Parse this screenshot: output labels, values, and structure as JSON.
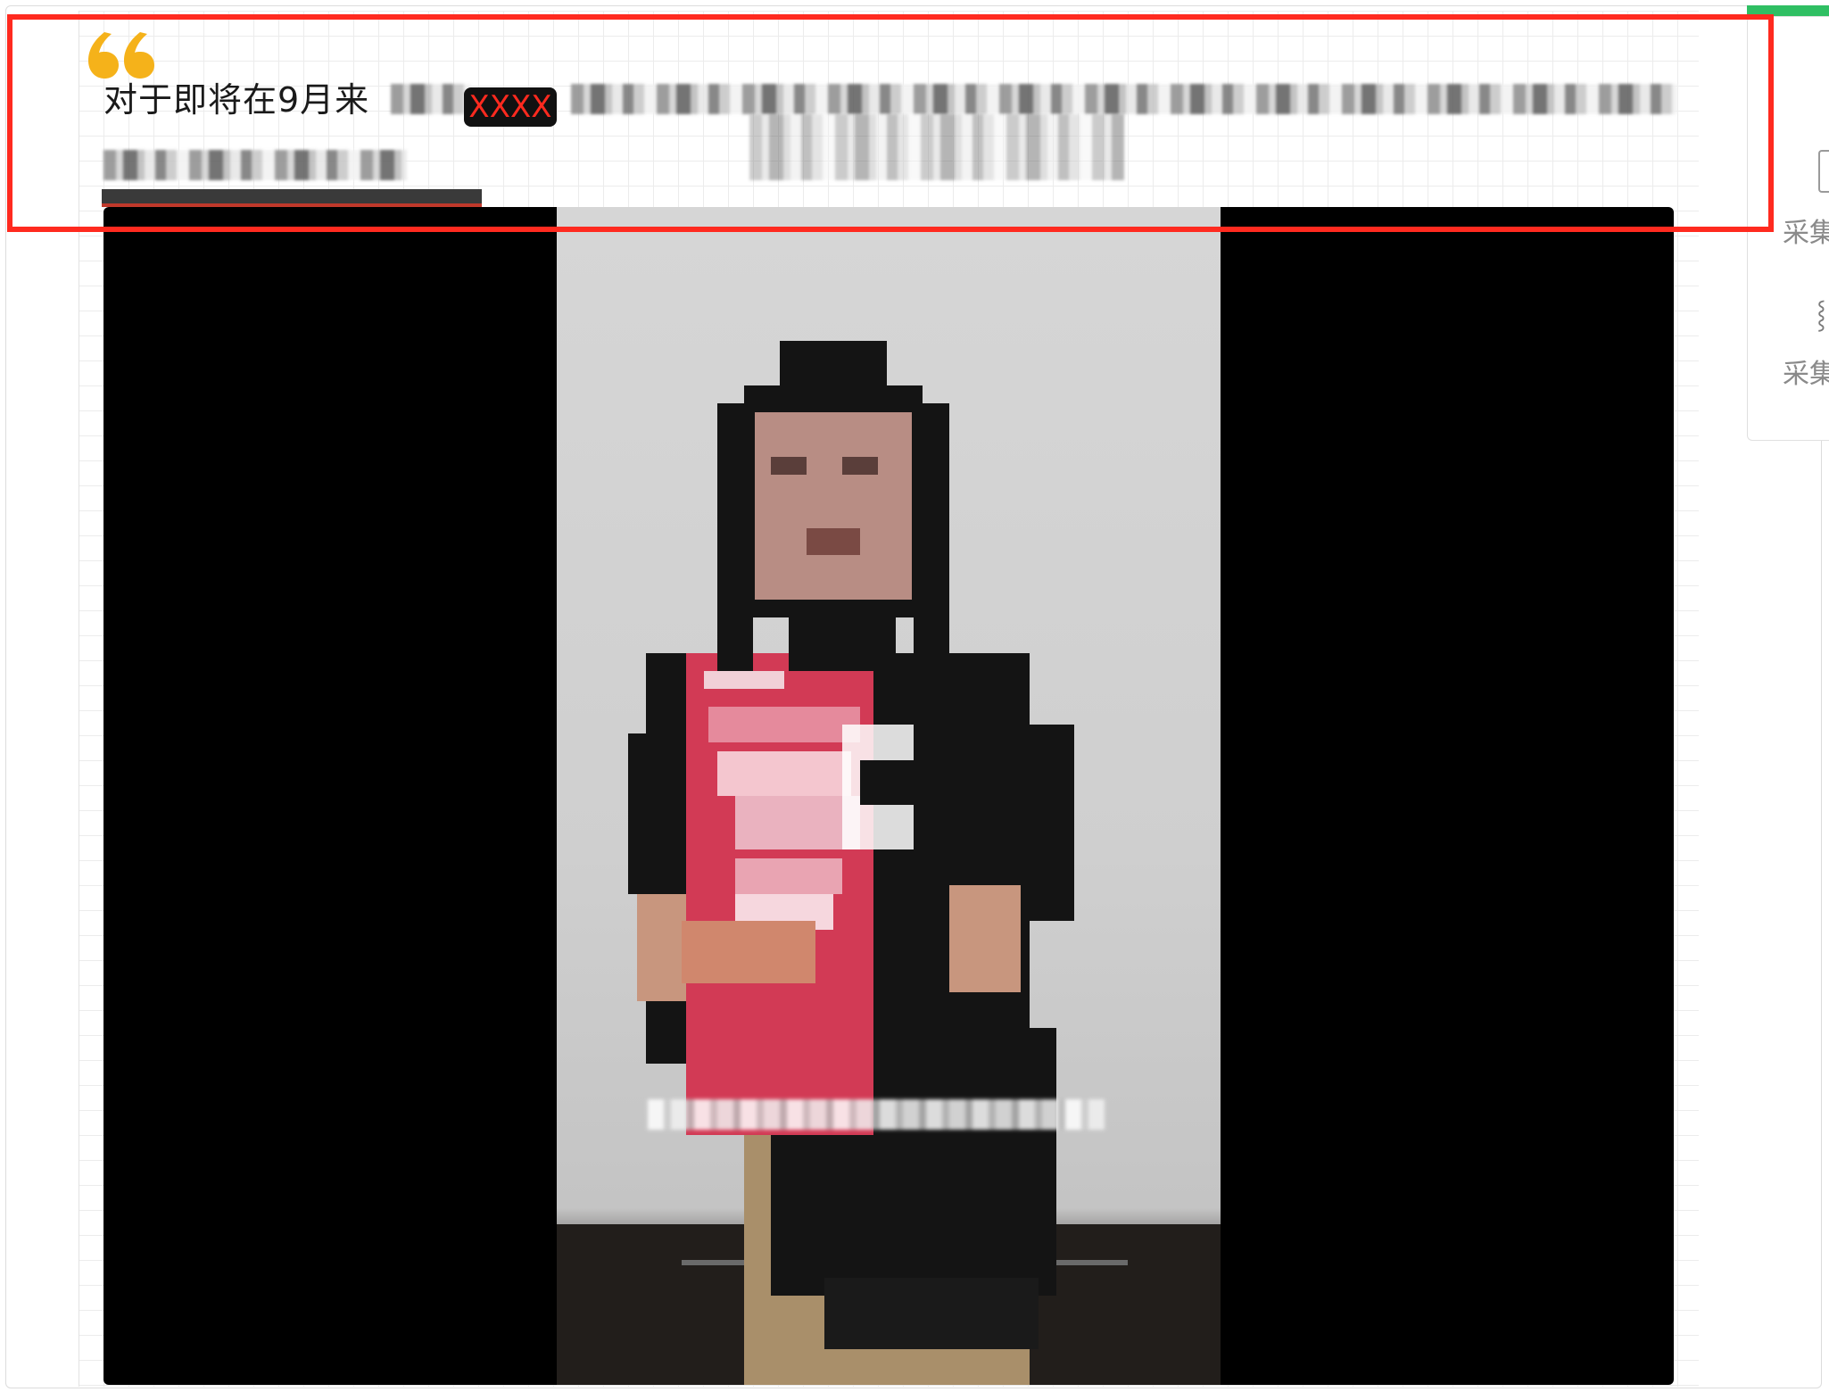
{
  "quote": {
    "text": "对于即将在9月来",
    "badge": "XXXX",
    "icon": "open-quote-icon"
  },
  "progress": {
    "fraction": 1.0
  },
  "side_panel": {
    "label_1": "采集",
    "label_2": "采集",
    "icon_bits": "⸾"
  },
  "colors": {
    "quote_icon": "#f5b21a",
    "annotation": "#ff2a1f",
    "badge_bg": "#111111",
    "badge_text": "#ff2a1f",
    "side_accent": "#2fbf63"
  }
}
